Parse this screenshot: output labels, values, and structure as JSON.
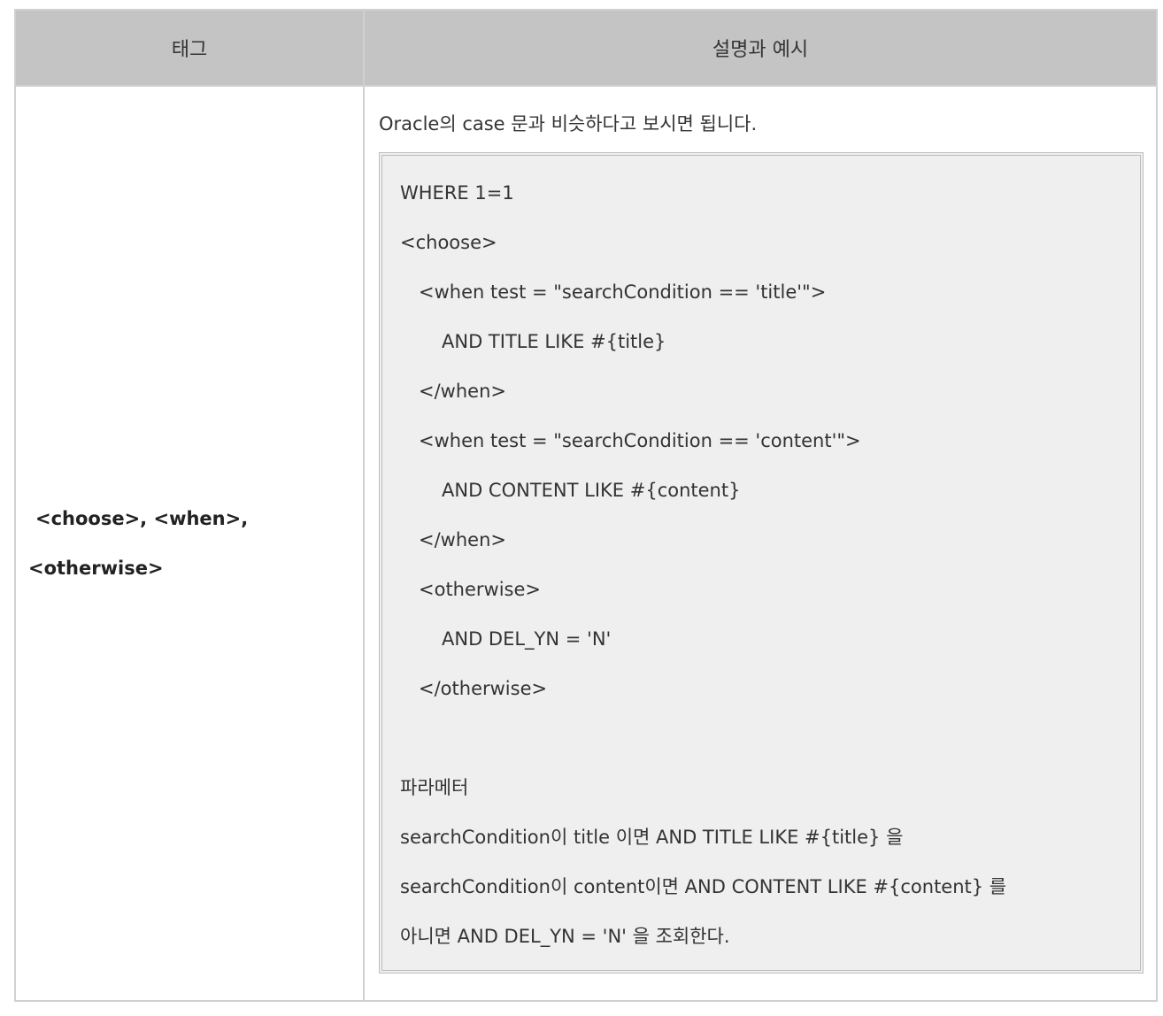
{
  "table": {
    "headers": {
      "tag": "태그",
      "description": "설명과 예시"
    },
    "row": {
      "tag_lines": [
        "<choose>, <when>,",
        "<otherwise>"
      ],
      "intro": "Oracle의 case 문과 비슷하다고 보시면 됩니다.",
      "code_lines": [
        "WHERE 1=1",
        "<choose>",
        "<when test = \"searchCondition == 'title'\">",
        "AND TITLE LIKE #{title}",
        "</when>",
        "<when test = \"searchCondition == 'content'\">",
        "AND CONTENT LIKE #{content}",
        "</when>",
        "<otherwise>",
        "AND DEL_YN = 'N'",
        "</otherwise>"
      ],
      "param_title": "파라메터",
      "param_lines": [
        "searchCondition이 title 이면 AND TITLE LIKE #{title} 을",
        "searchCondition이 content이면 AND CONTENT LIKE #{content} 를",
        "아니면 AND DEL_YN = 'N' 을 조회한다."
      ]
    }
  },
  "colors": {
    "header_bg": "#c4c4c4",
    "code_bg": "#efefef",
    "border": "#d0d0d0"
  }
}
